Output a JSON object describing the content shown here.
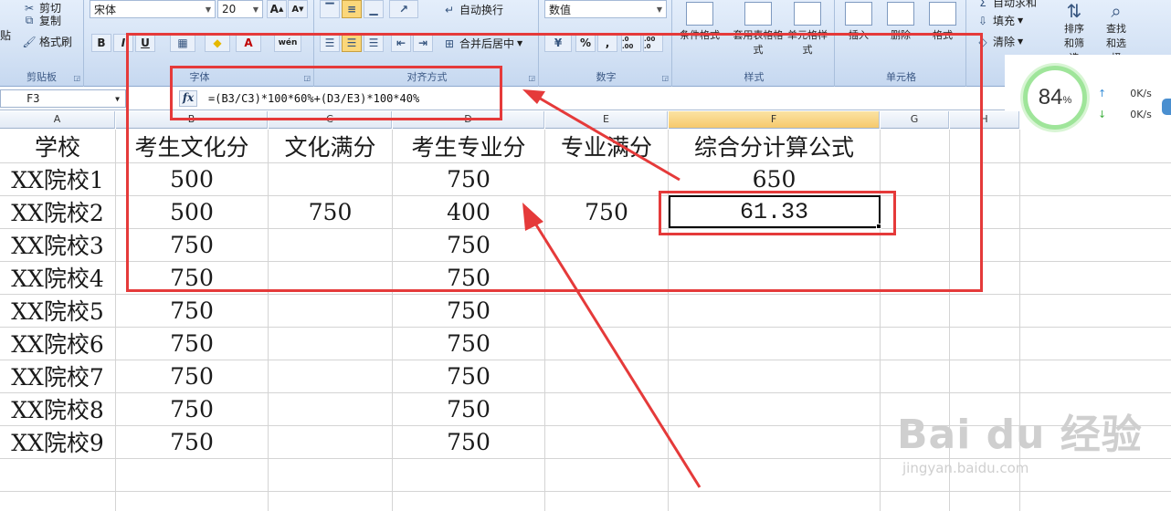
{
  "ribbon": {
    "clipboard": {
      "label": "剪贴板",
      "paste": "贴",
      "cut": "剪切",
      "copy": "复制",
      "format_painter": "格式刷"
    },
    "font": {
      "label": "字体",
      "name": "宋体",
      "size": "20",
      "bold": "B",
      "italic": "I",
      "underline": "U",
      "grow": "A",
      "shrink": "A",
      "font_color": "A",
      "phonetic": "wén"
    },
    "alignment": {
      "label": "对齐方式",
      "wrap_text": "自动换行",
      "merge_center": "合并后居中"
    },
    "number": {
      "label": "数字",
      "format": "数值",
      "percent": "%",
      "comma": ",",
      "inc_decimal": ".0 .00",
      "dec_decimal": ".00 .0"
    },
    "styles": {
      "label": "样式",
      "conditional": "条件格式",
      "table_format": "套用表格格式",
      "cell_styles": "单元格样式"
    },
    "cells": {
      "label": "单元格",
      "insert": "插入",
      "delete": "删除",
      "format": "格式"
    },
    "editing": {
      "autosum": "自动求和",
      "fill": "填充",
      "clear": "清除",
      "sort_filter": "排序和筛选",
      "find_select": "查找和选择"
    }
  },
  "formula_bar": {
    "name_box": "F3",
    "fx": "fx",
    "formula": "=(B3/C3)*100*60%+(D3/E3)*100*40%"
  },
  "widget": {
    "percent": "84",
    "percent_sign": "%",
    "up_speed": "0K/s",
    "down_speed": "0K/s"
  },
  "columns": [
    "A",
    "B",
    "C",
    "D",
    "E",
    "F",
    "G",
    "H"
  ],
  "rows": [
    [
      "学校",
      "考生文化分",
      "文化满分",
      "考生专业分",
      "专业满分",
      "综合分计算公式"
    ],
    [
      "XX院校1",
      "500",
      "",
      "750",
      "",
      "650"
    ],
    [
      "XX院校2",
      "500",
      "750",
      "400",
      "750",
      "61.33"
    ],
    [
      "XX院校3",
      "750",
      "",
      "750",
      "",
      ""
    ],
    [
      "XX院校4",
      "750",
      "",
      "750",
      "",
      ""
    ],
    [
      "XX院校5",
      "750",
      "",
      "750",
      "",
      ""
    ],
    [
      "XX院校6",
      "750",
      "",
      "750",
      "",
      ""
    ],
    [
      "XX院校7",
      "750",
      "",
      "750",
      "",
      ""
    ],
    [
      "XX院校8",
      "750",
      "",
      "750",
      "",
      ""
    ],
    [
      "XX院校9",
      "750",
      "",
      "750",
      "",
      ""
    ]
  ],
  "watermark": {
    "brand": "Bai du 经验",
    "url": "jingyan.baidu.com"
  },
  "colors": {
    "annotation": "#e53a3a",
    "selected_header": "#f6c96c",
    "ribbon": "#d5e3f5"
  }
}
